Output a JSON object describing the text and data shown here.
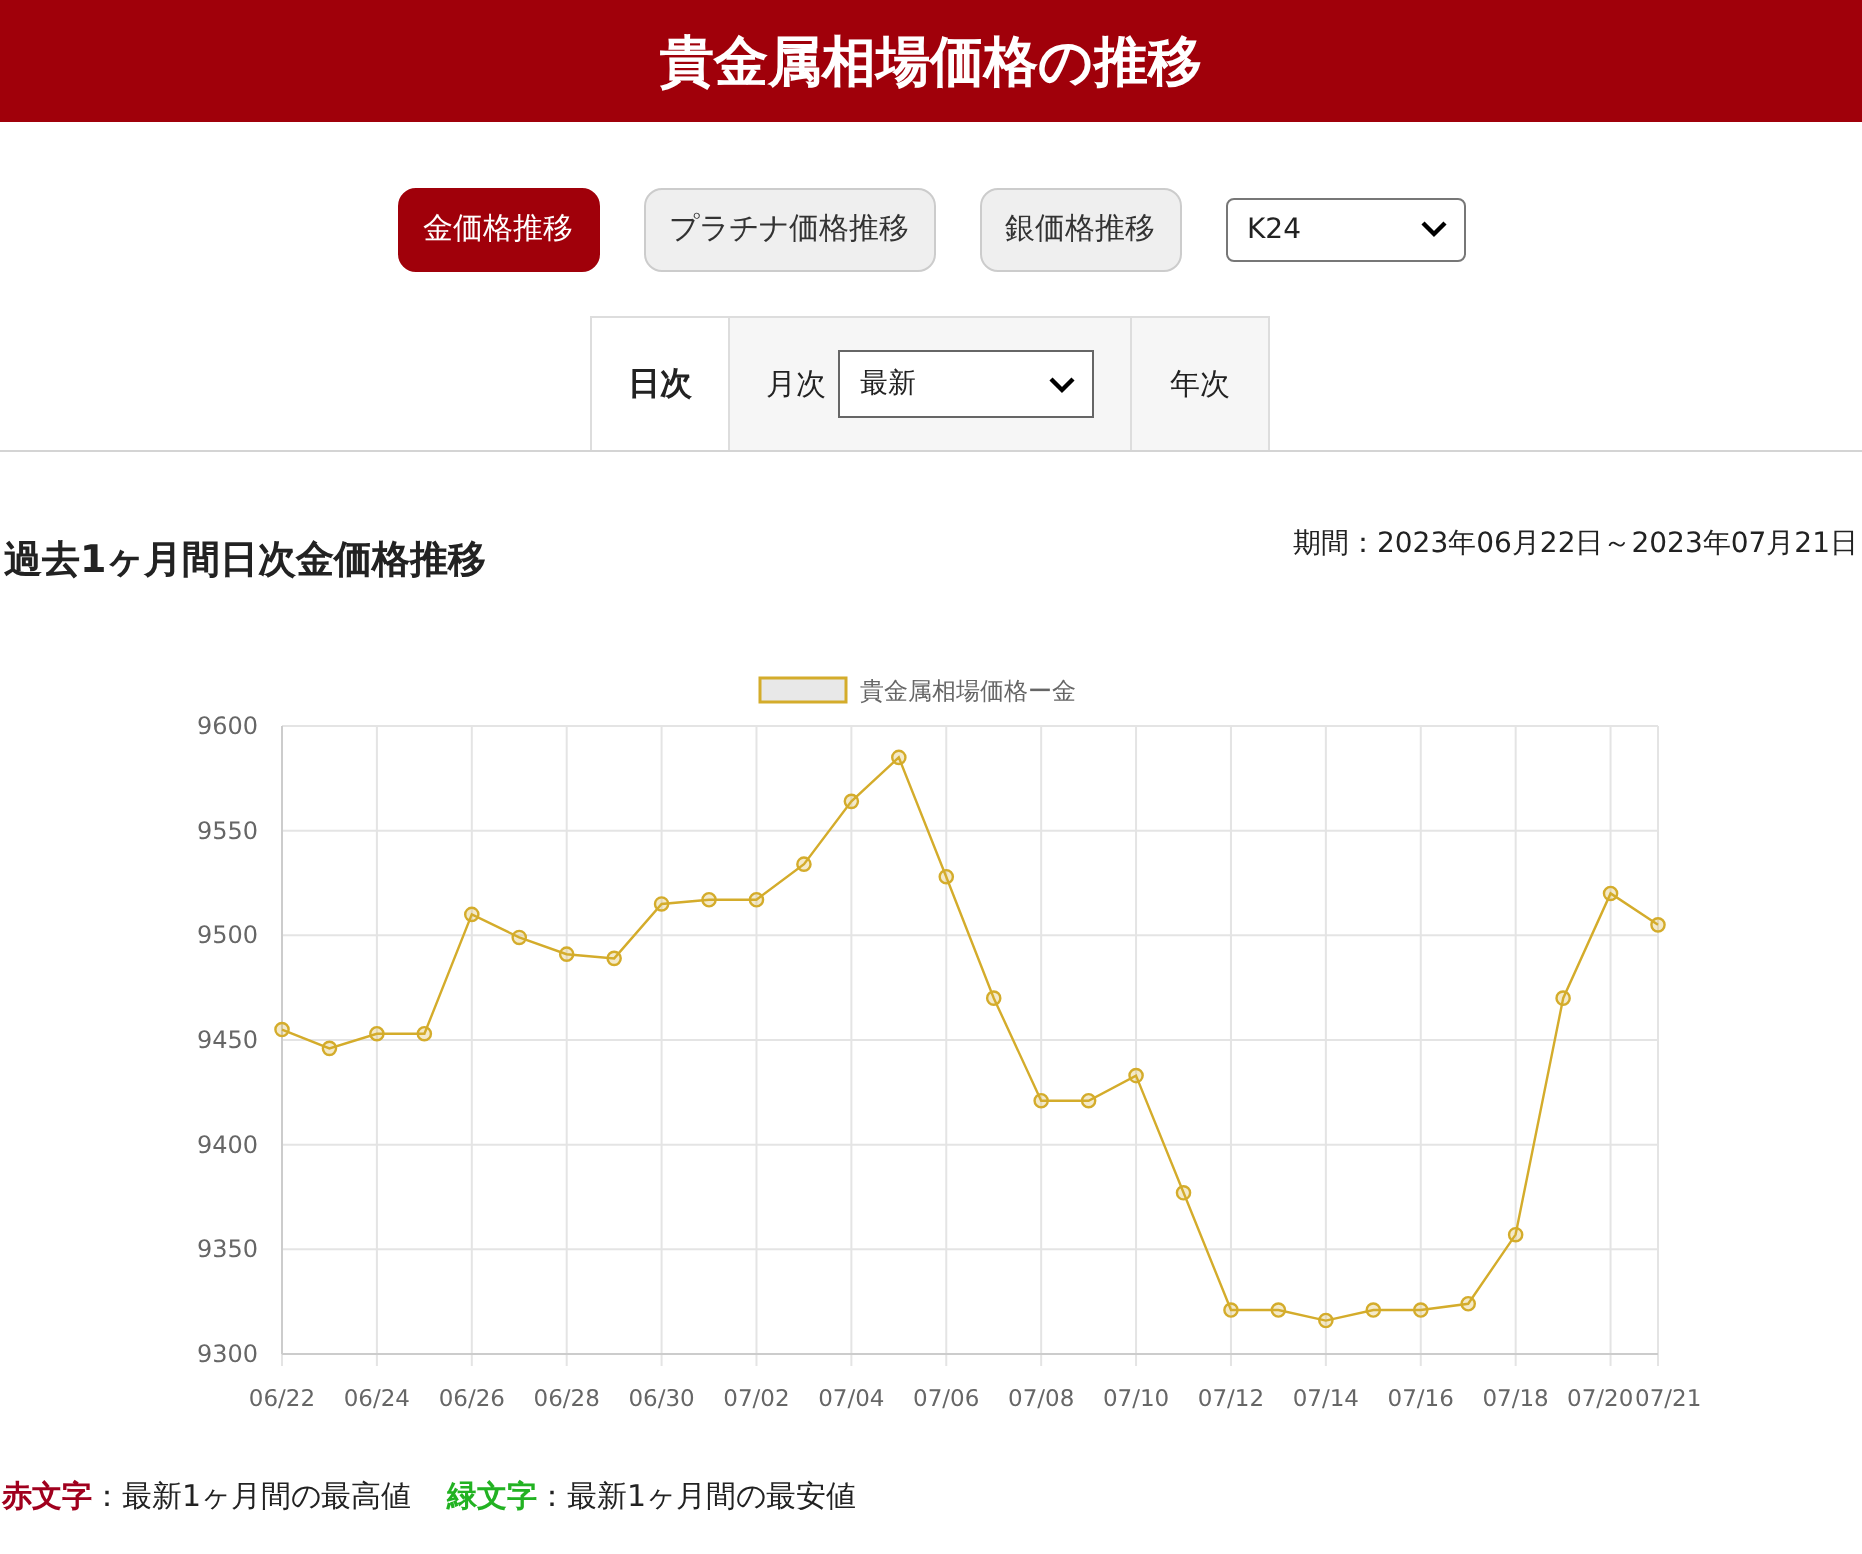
{
  "header": {
    "title": "貴金属相場価格の推移"
  },
  "metal_buttons": [
    {
      "label": "金価格推移",
      "selected": true
    },
    {
      "label": "プラチナ価格推移",
      "selected": false
    },
    {
      "label": "銀価格推移",
      "selected": false
    }
  ],
  "purity_select": {
    "value": "K24"
  },
  "period_tabs": [
    {
      "kind": "plain",
      "label": "日次",
      "selected": true
    },
    {
      "kind": "select",
      "label": "月次",
      "value": "最新",
      "selected": false
    },
    {
      "kind": "plain",
      "label": "年次",
      "selected": false
    }
  ],
  "section": {
    "title": "過去1ヶ月間日次金価格推移",
    "period": "期間：2023年06月22日～2023年07月21日"
  },
  "chart": {
    "chart_data": {
      "type": "line",
      "grid": true,
      "categories": [
        "06/22",
        null,
        "06/24",
        null,
        "06/26",
        null,
        "06/28",
        null,
        "06/30",
        null,
        "07/02",
        null,
        "07/04",
        null,
        "07/06",
        null,
        "07/08",
        null,
        "07/10",
        null,
        "07/12",
        null,
        "07/14",
        null,
        "07/16",
        null,
        "07/18",
        null,
        "07/20",
        "07/21"
      ],
      "series": [
        {
          "name": "貴金属相場価格ー金",
          "color": "#d4ac2b",
          "marker": "circle",
          "values": [
            9455,
            9446,
            9453,
            9453,
            9510,
            9499,
            9491,
            9489,
            9515,
            9517,
            9517,
            9534,
            9564,
            9585,
            9528,
            9470,
            9421,
            9421,
            9433,
            9377,
            9321,
            9321,
            9316,
            9321,
            9321,
            9324,
            9357,
            9470,
            9520,
            9505
          ]
        }
      ],
      "ylim": [
        9300,
        9600
      ],
      "yticks": [
        9300,
        9350,
        9400,
        9450,
        9500,
        9550,
        9600
      ]
    }
  },
  "notes": [
    {
      "label": "赤文字",
      "text": "：最新1ヶ月間の最高値",
      "color": "#a0001e"
    },
    {
      "label": "緑文字",
      "text": "：最新1ヶ月間の最安値",
      "color": "#22b222"
    }
  ]
}
